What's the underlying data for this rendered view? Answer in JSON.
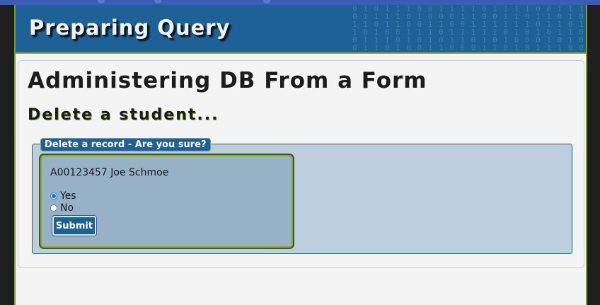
{
  "banner": {
    "title": "Preparing Query",
    "binary_pattern": "0 1 0 1 1 1 0 0 1 1 1 1 0 1 1 1 1 0 0 1 1 1 1 1 1\n0 1 1 1 1 0 1 0 0 0 1 1 0 0 1 1 0 1 1 0 1 0 0 1 0 0\n1 1 0 1 1 0 0 1 1 0 0 1 1 1 1 1 1 0 1 1 0 1 0 1\n1 0 1 0 0 1 1 1 0 1 1 1 1 1 0 1 0 1 0 1 1 0 1 0 1\n0 1 1 1 0 1 0 1 0 1 1 0 1 0 1 0 0 0 1 0 1 0 0 0 0\n0 1 1 0 1 0 0 1 1 0 0 0 1 1 0 1 0 1 1 1 0 0 1 0"
  },
  "page": {
    "heading": "Administering DB From a Form",
    "subheading": "Delete a student..."
  },
  "form": {
    "legend": "Delete a record - Are you sure?",
    "record": "A00123457 Joe Schmoe",
    "options": [
      {
        "label": "Yes",
        "checked": true
      },
      {
        "label": "No",
        "checked": false
      }
    ],
    "submit_label": "Submit"
  },
  "colors": {
    "banner_blue": "#1d6196",
    "accent_green": "#8aa535",
    "fieldset_bg": "#bdcedd",
    "card_bg": "#97b2c6"
  }
}
